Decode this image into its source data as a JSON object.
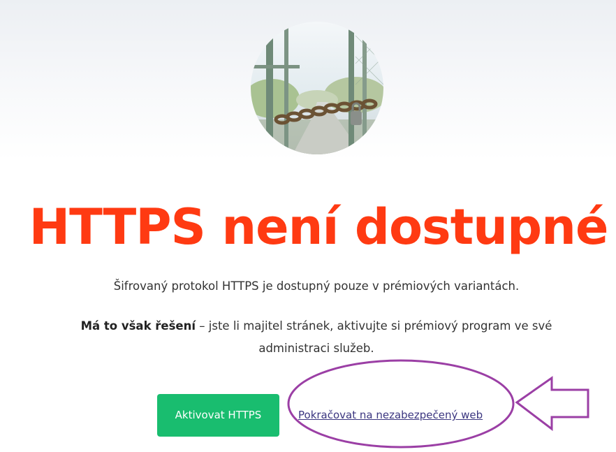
{
  "hero": {
    "image_name": "locked-gate-photo"
  },
  "title": "HTTPS není dostupné",
  "description": "Šifrovaný protokol HTTPS je dostupný pouze v prémiových variantách.",
  "solution": {
    "bold": "Má to však řešení",
    "text": " – jste li majitel stránek, aktivujte si prémiový program ve své administraci služeb."
  },
  "actions": {
    "activate_label": "Aktivovat HTTPS",
    "continue_label": "Pokračovat na nezabezpečený web"
  },
  "colors": {
    "title": "#ff3a12",
    "button": "#19bd6f",
    "link": "#3b3680",
    "annotation": "#9b3fa5"
  }
}
